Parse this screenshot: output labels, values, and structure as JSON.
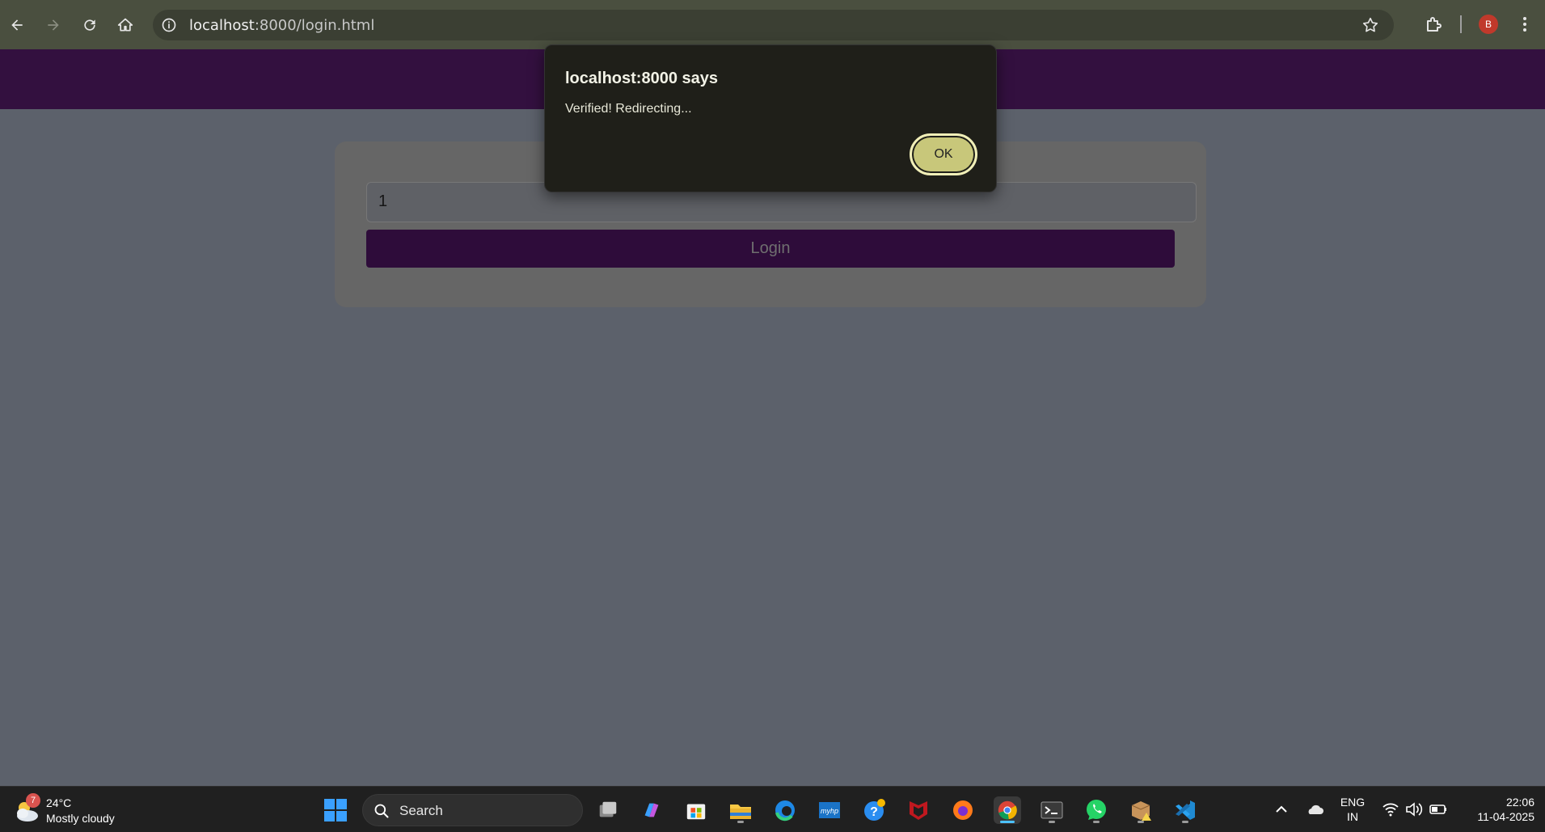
{
  "browser": {
    "url_host": "localhost",
    "url_rest": ":8000/login.html",
    "profile_initial": "B"
  },
  "page": {
    "input_value": "1",
    "login_label": "Login"
  },
  "dialog": {
    "title": "localhost:8000 says",
    "message": "Verified! Redirecting...",
    "ok_label": "OK"
  },
  "taskbar": {
    "weather_temp": "24°C",
    "weather_condition": "Mostly cloudy",
    "weather_badge": "7",
    "search_label": "Search",
    "lang_line1": "ENG",
    "lang_line2": "IN",
    "time": "22:06",
    "date": "11-04-2025",
    "apps": [
      "start-icon",
      "task-view-icon",
      "copilot-icon",
      "store-icon",
      "file-explorer-icon",
      "edge-icon",
      "myhp-icon",
      "help-icon",
      "mcafee-icon",
      "firefox-icon",
      "chrome-icon",
      "terminal-icon",
      "whatsapp-icon",
      "package-icon",
      "vscode-icon"
    ]
  },
  "colors": {
    "header": "#33103f",
    "dialog_bg": "#1f1f19",
    "ok_button": "#c8c77a",
    "page_bg": "#5c616b"
  }
}
